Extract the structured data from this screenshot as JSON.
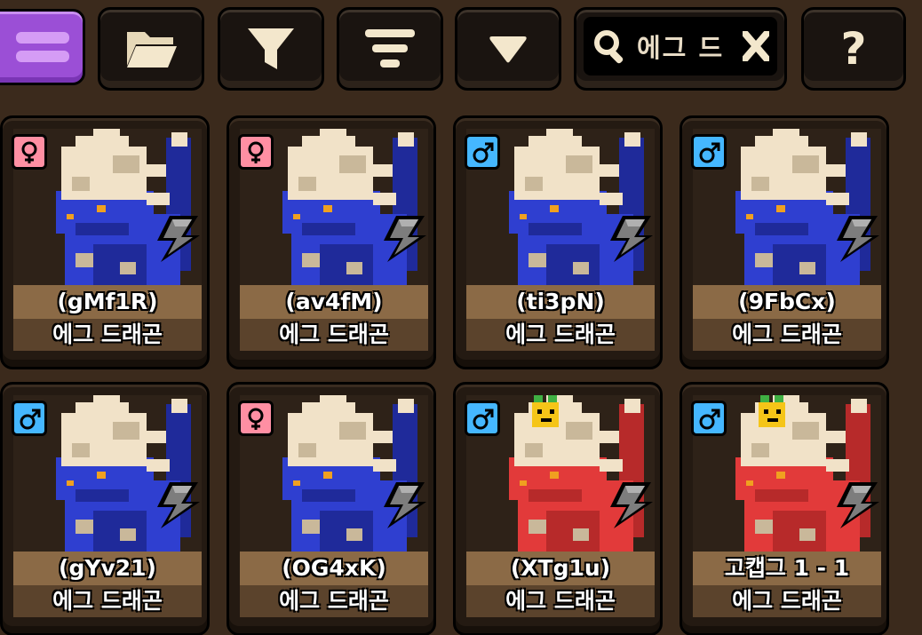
{
  "toolbar": {
    "buttons": [
      {
        "id": "menu",
        "icon": "hamburger-menu-icon",
        "color": "#9b4fd6"
      },
      {
        "id": "folder",
        "icon": "folder-icon"
      },
      {
        "id": "filter",
        "icon": "filter-funnel-icon"
      },
      {
        "id": "sort",
        "icon": "sort-lines-icon"
      },
      {
        "id": "dropdown",
        "icon": "triangle-down-icon"
      }
    ],
    "search": {
      "value": "에그 드",
      "icon": "magnifier-icon",
      "clear_icon": "clear-x-icon"
    },
    "help": {
      "icon": "question-mark-icon",
      "label": "?"
    }
  },
  "cards": [
    {
      "code": "(gMf1R)",
      "name": "에그 드래곤",
      "gender": "female",
      "color": "blue",
      "hat": false
    },
    {
      "code": "(av4fM)",
      "name": "에그 드래곤",
      "gender": "female",
      "color": "blue",
      "hat": false
    },
    {
      "code": "(ti3pN)",
      "name": "에그 드래곤",
      "gender": "male",
      "color": "blue",
      "hat": false
    },
    {
      "code": "(9FbCx)",
      "name": "에그 드래곤",
      "gender": "male",
      "color": "blue",
      "hat": false
    },
    {
      "code": "(gYv21)",
      "name": "에그 드래곤",
      "gender": "male",
      "color": "blue",
      "hat": false
    },
    {
      "code": "(OG4xK)",
      "name": "에그 드래곤",
      "gender": "female",
      "color": "blue",
      "hat": false
    },
    {
      "code": "(XTg1u)",
      "name": "에그 드래곤",
      "gender": "male",
      "color": "red",
      "hat": true
    },
    {
      "code": "고캡그 1 - 1",
      "name": "에그 드래곤",
      "gender": "male",
      "color": "red",
      "hat": true
    }
  ],
  "colors": {
    "background": "#3b2a1c",
    "female_badge": "#ff8fa3",
    "male_badge": "#45b7ff",
    "blue_dragon": "#2f3fd0",
    "red_dragon": "#e23a3a",
    "cream": "#f1e2c8"
  }
}
